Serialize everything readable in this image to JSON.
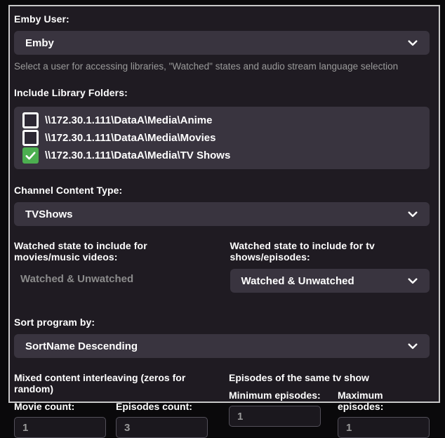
{
  "colors": {
    "accent_green": "#4caf50",
    "card_bg": "#1f1b22",
    "control_bg": "#39343f",
    "window_border": "#c9c9c9",
    "muted_text": "#9a9a9a"
  },
  "emby_user": {
    "label": "Emby User:",
    "value": "Emby",
    "help": "Select a user for accessing libraries, \"Watched\" states and audio stream language selection"
  },
  "library_folders": {
    "label": "Include Library Folders:",
    "items": [
      {
        "path": "\\\\172.30.1.111\\DataA\\Media\\Anime",
        "checked": false
      },
      {
        "path": "\\\\172.30.1.111\\DataA\\Media\\Movies",
        "checked": false
      },
      {
        "path": "\\\\172.30.1.111\\DataA\\Media\\TV Shows",
        "checked": true
      }
    ]
  },
  "channel_content_type": {
    "label": "Channel Content Type:",
    "value": "TVShows"
  },
  "watched_movies": {
    "label": "Watched state to include for movies/music videos:",
    "value": "Watched & Unwatched",
    "disabled": true
  },
  "watched_tv": {
    "label": "Watched state to include for tv shows/episodes:",
    "value": "Watched & Unwatched"
  },
  "sort_by": {
    "label": "Sort program by:",
    "value": "SortName Descending"
  },
  "interleaving": {
    "group_label": "Mixed content interleaving (zeros for random)",
    "movie_count": {
      "label": "Movie count:",
      "value": "1"
    },
    "episodes_count": {
      "label": "Episodes count:",
      "value": "3"
    }
  },
  "same_show": {
    "group_label": "Episodes of the same tv show",
    "min_episodes": {
      "label": "Minimum episodes:",
      "value": "1"
    },
    "max_episodes": {
      "label": "Maximum episodes:",
      "value": "1"
    }
  }
}
